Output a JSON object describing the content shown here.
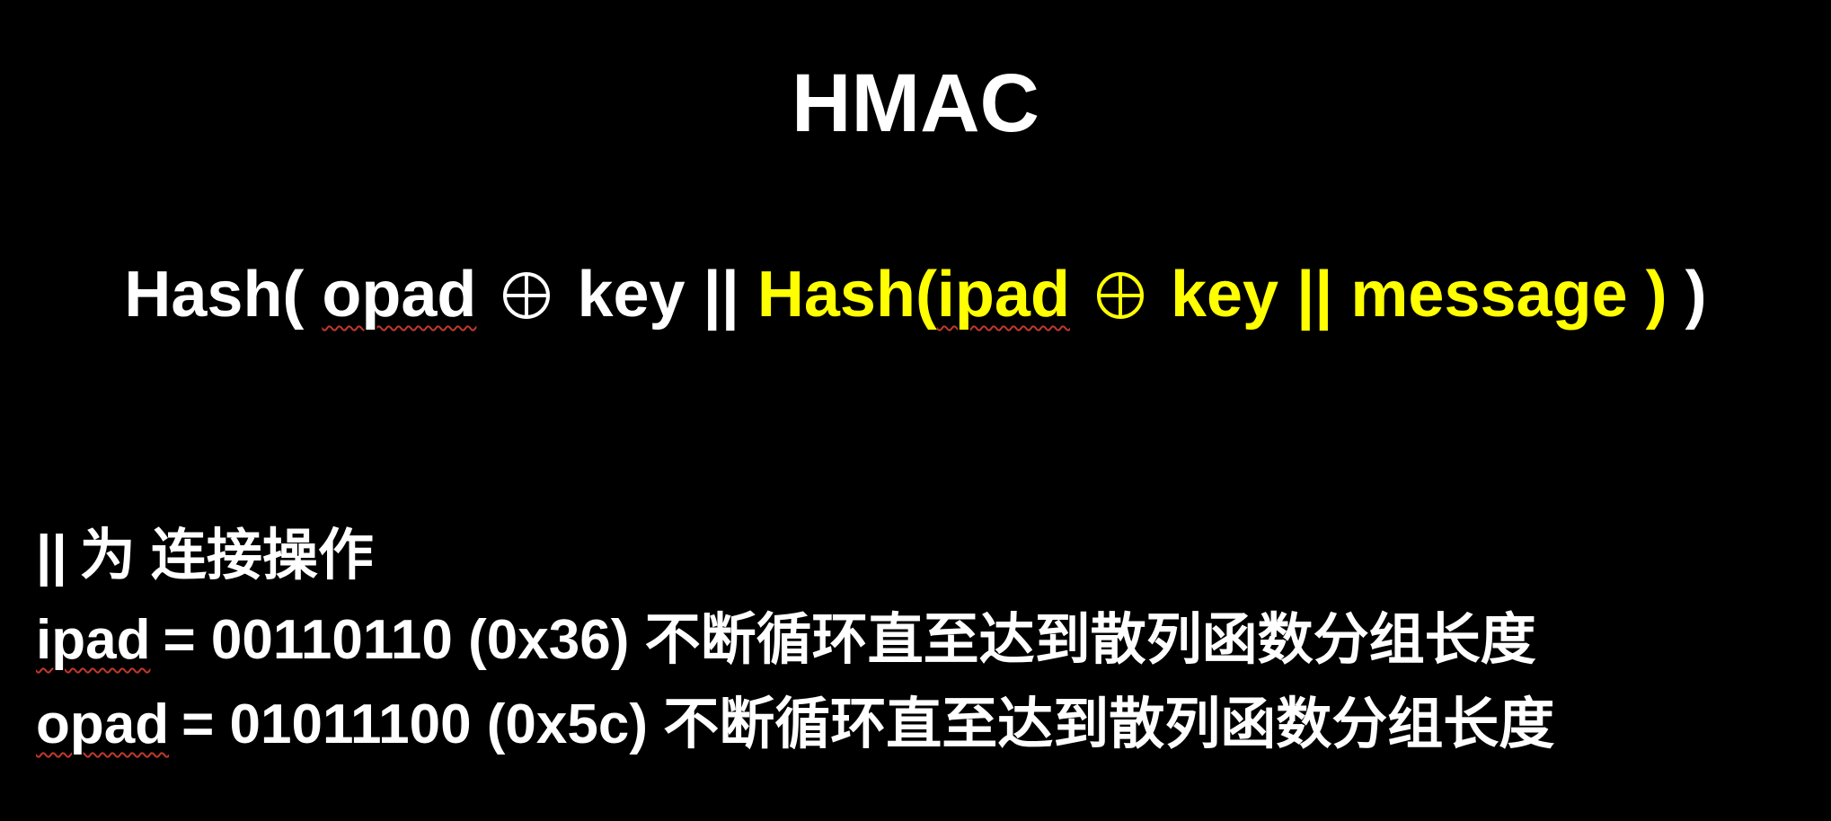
{
  "slide": {
    "title": "HMAC",
    "formula": {
      "outer": {
        "hash_open": "Hash(",
        "opad": "opad",
        "key_concat": "key ||",
        "close": ")"
      },
      "inner": {
        "hash_open": "Hash(",
        "ipad": "ipad",
        "key_concat": "key ||",
        "message": "message",
        "close": ")"
      },
      "xor_symbol_name": "circled-plus-icon"
    },
    "notes": [
      {
        "prefix": "||",
        "text": "为 连接操作"
      },
      {
        "prefix": "ipad",
        "text": "= 00110110 (0x36) 不断循环直至达到散列函数分组长度"
      },
      {
        "prefix": "opad",
        "text": "= 01011100 (0x5c) 不断循环直至达到散列函数分组长度"
      }
    ],
    "colors": {
      "background": "#000000",
      "primary_text": "#ffffff",
      "highlight_text": "#ffff00",
      "spellcheck_underline": "#c0392b"
    }
  }
}
